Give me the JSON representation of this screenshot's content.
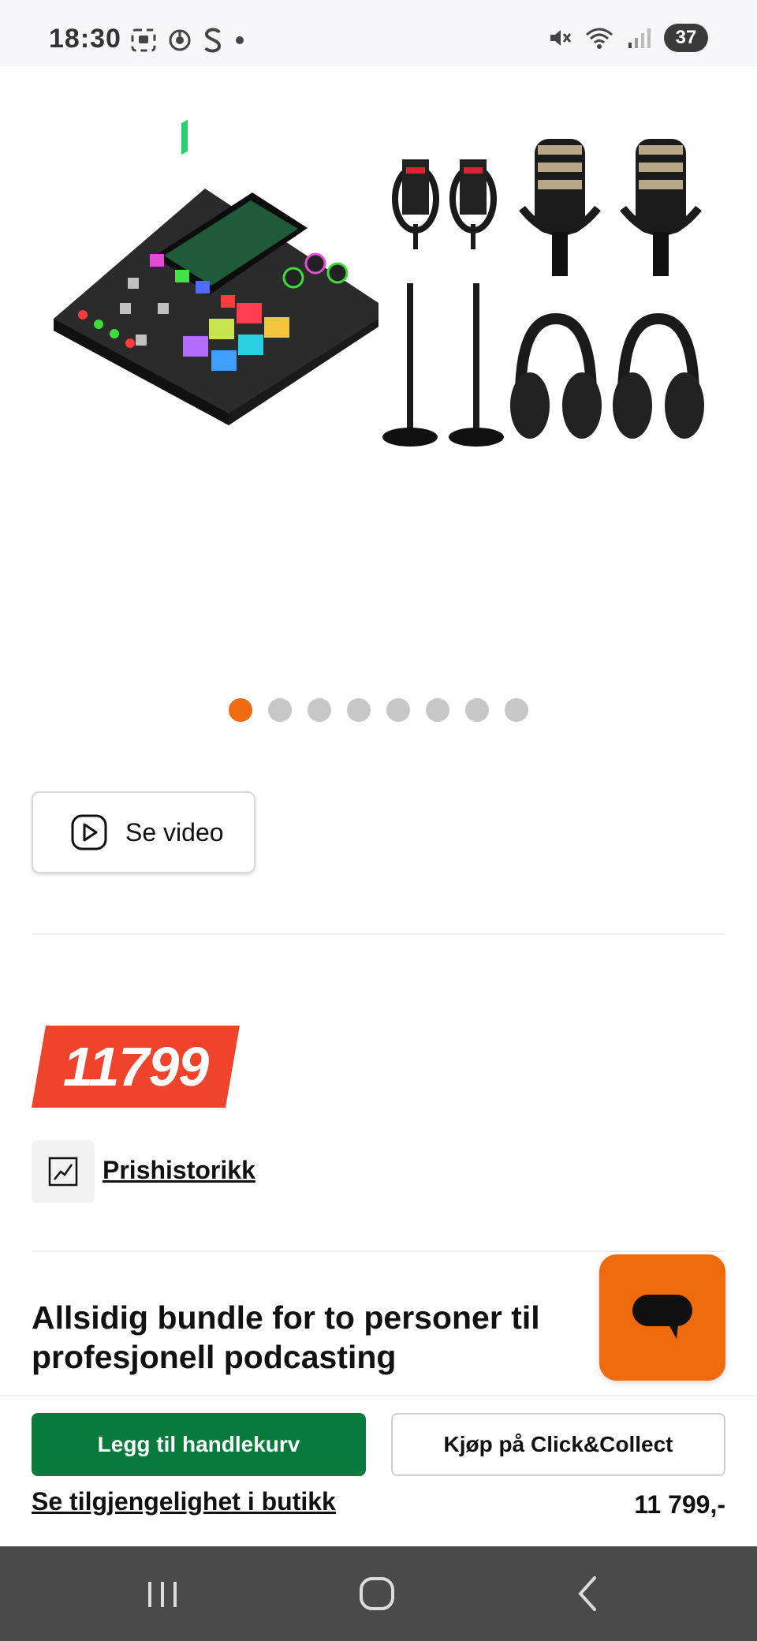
{
  "status_bar": {
    "time": "18:30",
    "battery": "37",
    "left_icons": [
      "screenshot-icon",
      "chrome-icon",
      "s-app-icon",
      "notification-dot-icon"
    ],
    "right_icons": [
      "mute-icon",
      "wifi-icon",
      "signal-icon"
    ]
  },
  "gallery": {
    "slide_count": 8,
    "active_index": 0,
    "items": [
      "mixer",
      "cable",
      "cable",
      "microphone",
      "microphone",
      "stand",
      "stand",
      "headphones",
      "headphones"
    ]
  },
  "video_button": {
    "label": "Se video",
    "icon": "play-icon"
  },
  "price": {
    "tag": "11799"
  },
  "price_history": {
    "label": "Prishistorikk",
    "icon": "chart-icon"
  },
  "product": {
    "title": "Allsidig bundle for to personer til profesjonell podcasting"
  },
  "chat": {
    "icon": "chat-bubble-icon"
  },
  "actions": {
    "add_to_cart": "Legg til handlekurv",
    "click_collect": "Kjøp på Click&Collect",
    "store_availability": "Se tilgjengelighet i butikk",
    "price": "11 799,-"
  },
  "nav": {
    "icons": [
      "recents-icon",
      "home-icon",
      "back-icon"
    ]
  },
  "colors": {
    "accent_orange": "#f06a0e",
    "price_red": "#f0432c",
    "cart_green": "#077a3c"
  }
}
